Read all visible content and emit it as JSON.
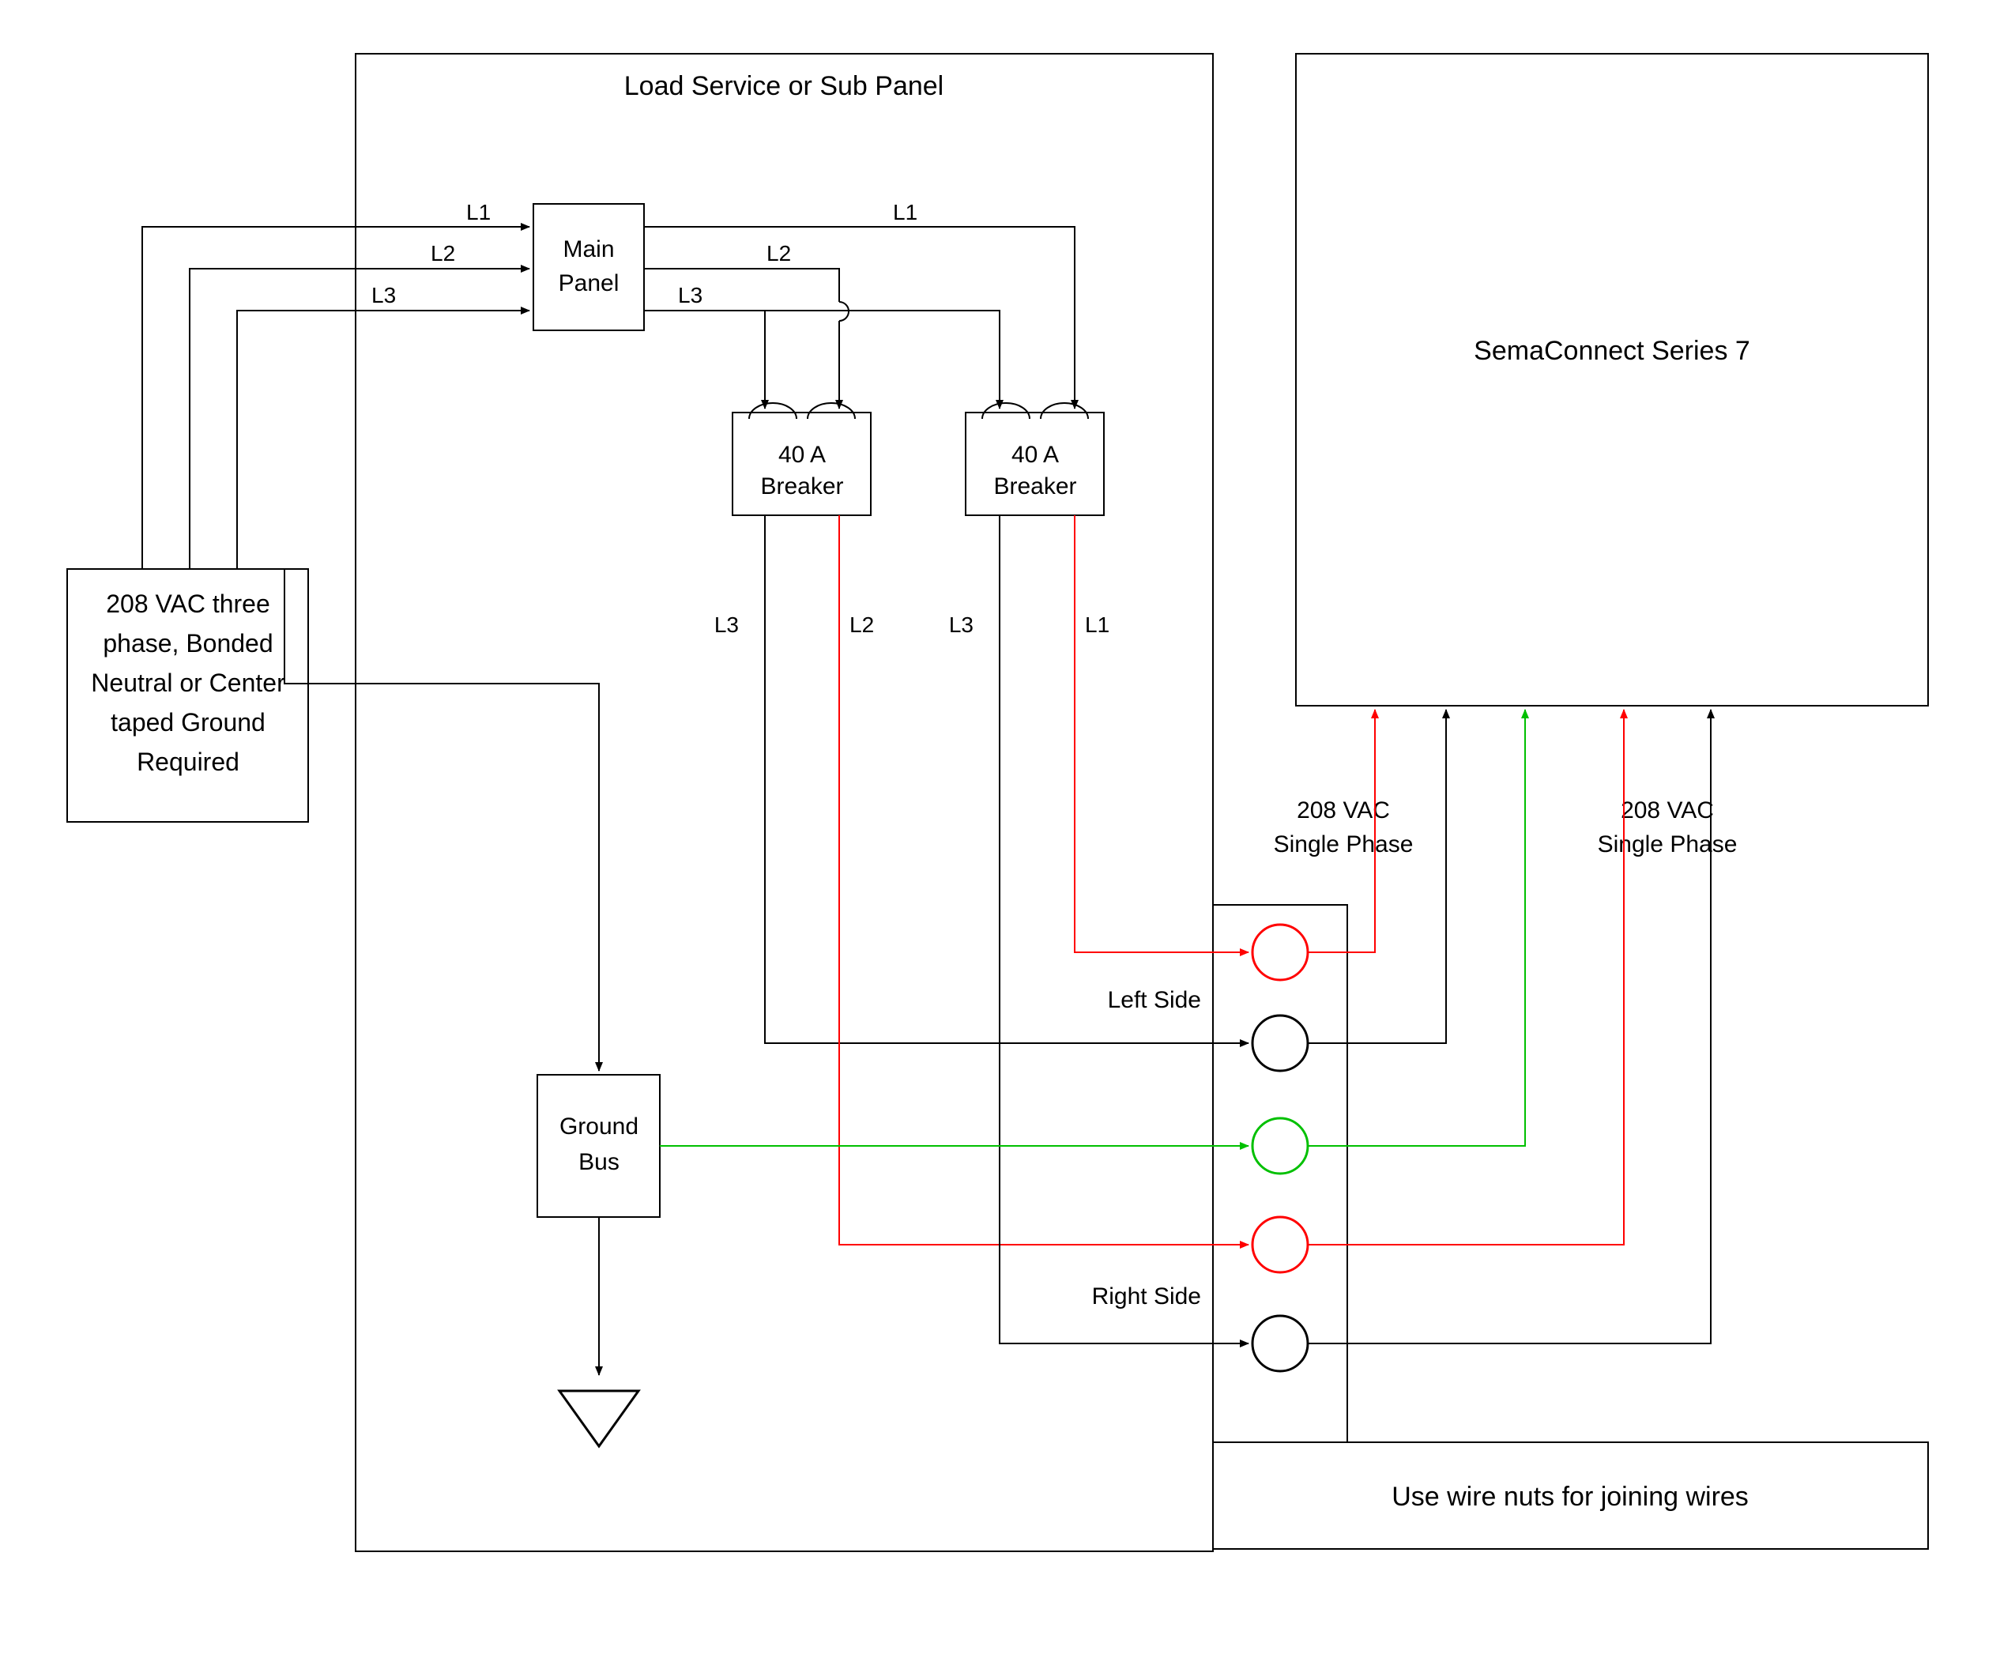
{
  "title": "Load Service or Sub Panel",
  "source": {
    "line1": "208 VAC three",
    "line2": "phase, Bonded",
    "line3": "Neutral or Center",
    "line4": "taped Ground",
    "line5": "Required"
  },
  "mainPanel": {
    "line1": "Main",
    "line2": "Panel"
  },
  "breaker1": {
    "line1": "40 A",
    "line2": "Breaker"
  },
  "breaker2": {
    "line1": "40 A",
    "line2": "Breaker"
  },
  "groundBus": {
    "line1": "Ground",
    "line2": "Bus"
  },
  "leftSide": "Left Side",
  "rightSide": "Right Side",
  "device": "SemaConnect Series 7",
  "wirenuts": "Use wire nuts for joining wires",
  "phase1": {
    "line1": "208 VAC",
    "line2": "Single Phase"
  },
  "phase2": {
    "line1": "208 VAC",
    "line2": "Single Phase"
  },
  "labels": {
    "L1_in": "L1",
    "L2_in": "L2",
    "L3_in": "L3",
    "L1_out": "L1",
    "L2_out": "L2",
    "L3_out": "L3",
    "brk1_L3": "L3",
    "brk1_L2": "L2",
    "brk2_L3": "L3",
    "brk2_L1": "L1"
  },
  "colors": {
    "black": "#000000",
    "red": "#ff0000",
    "green": "#00c000"
  }
}
